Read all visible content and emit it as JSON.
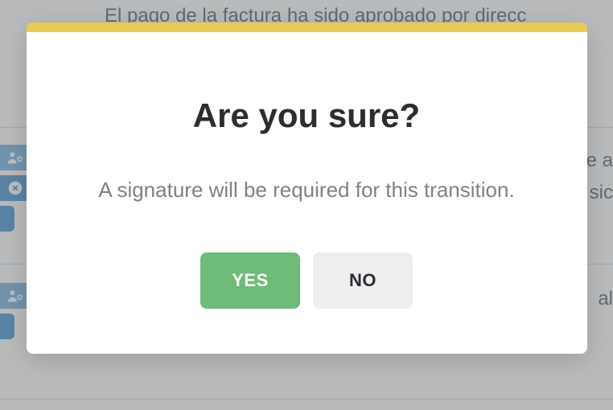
{
  "background": {
    "top_text": "El pago de la factura ha sido aprobado por direcc",
    "right_fragment_1": "e a",
    "right_fragment_2": "sic",
    "right_fragment_3": "al"
  },
  "modal": {
    "title": "Are you sure?",
    "message": "A signature will be required for this transition.",
    "yes_label": "YES",
    "no_label": "NO"
  },
  "colors": {
    "accent_bar": "#e8cb56",
    "confirm_button": "#6fbb79",
    "cancel_button": "#eceeef"
  }
}
